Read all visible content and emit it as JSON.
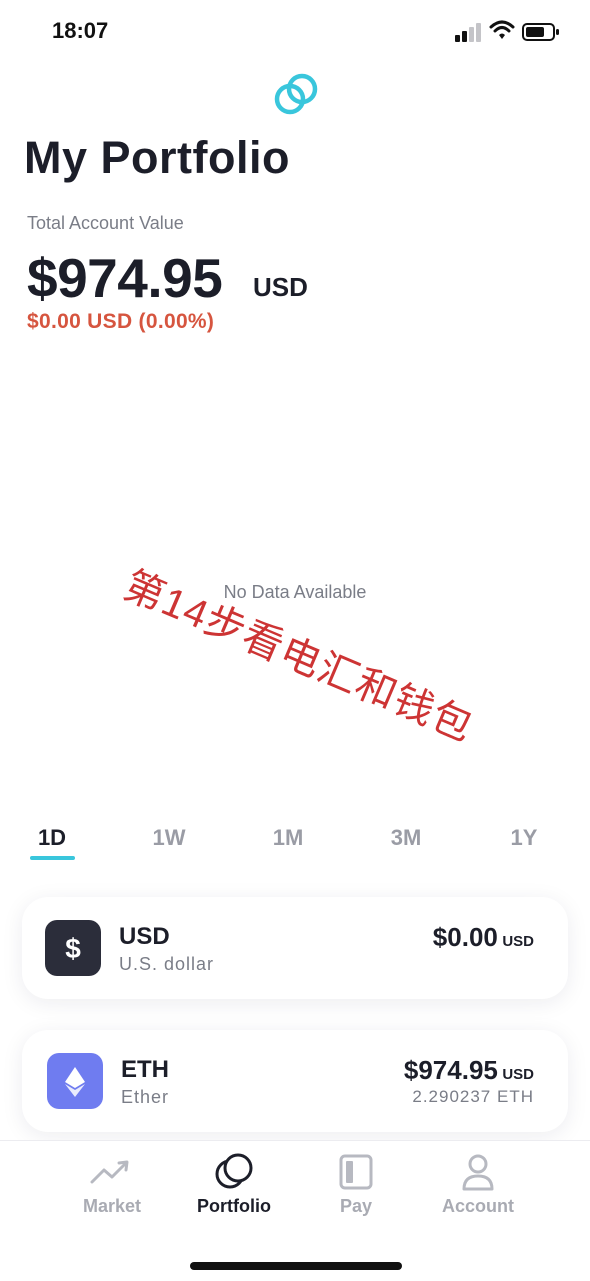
{
  "status_bar": {
    "time": "18:07"
  },
  "header": {
    "title": "My Portfolio"
  },
  "summary": {
    "label": "Total Account Value",
    "value": "$974.95",
    "unit": "USD",
    "change": "$0.00 USD (0.00%)"
  },
  "chart": {
    "empty_message": "No Data Available"
  },
  "watermark": {
    "text": "第14步看电汇和钱包"
  },
  "ranges": [
    "1D",
    "1W",
    "1M",
    "3M",
    "1Y"
  ],
  "selected_range": "1D",
  "assets": [
    {
      "symbol": "USD",
      "name": "U.S. dollar",
      "value": "$0.00",
      "unit": "USD",
      "quantity": ""
    },
    {
      "symbol": "ETH",
      "name": "Ether",
      "value": "$974.95",
      "unit": "USD",
      "quantity": "2.290237 ETH"
    }
  ],
  "nav": {
    "items": [
      {
        "label": "Market",
        "icon": "trend-icon"
      },
      {
        "label": "Portfolio",
        "icon": "portfolio-icon"
      },
      {
        "label": "Pay",
        "icon": "pay-icon"
      },
      {
        "label": "Account",
        "icon": "account-icon"
      }
    ],
    "active": "Portfolio"
  },
  "colors": {
    "accent": "#39c6dc",
    "negative": "#d6553f",
    "eth_icon_bg": "#6f7cf0",
    "usd_icon_bg": "#2b2d3a",
    "watermark": "#cd3434"
  }
}
